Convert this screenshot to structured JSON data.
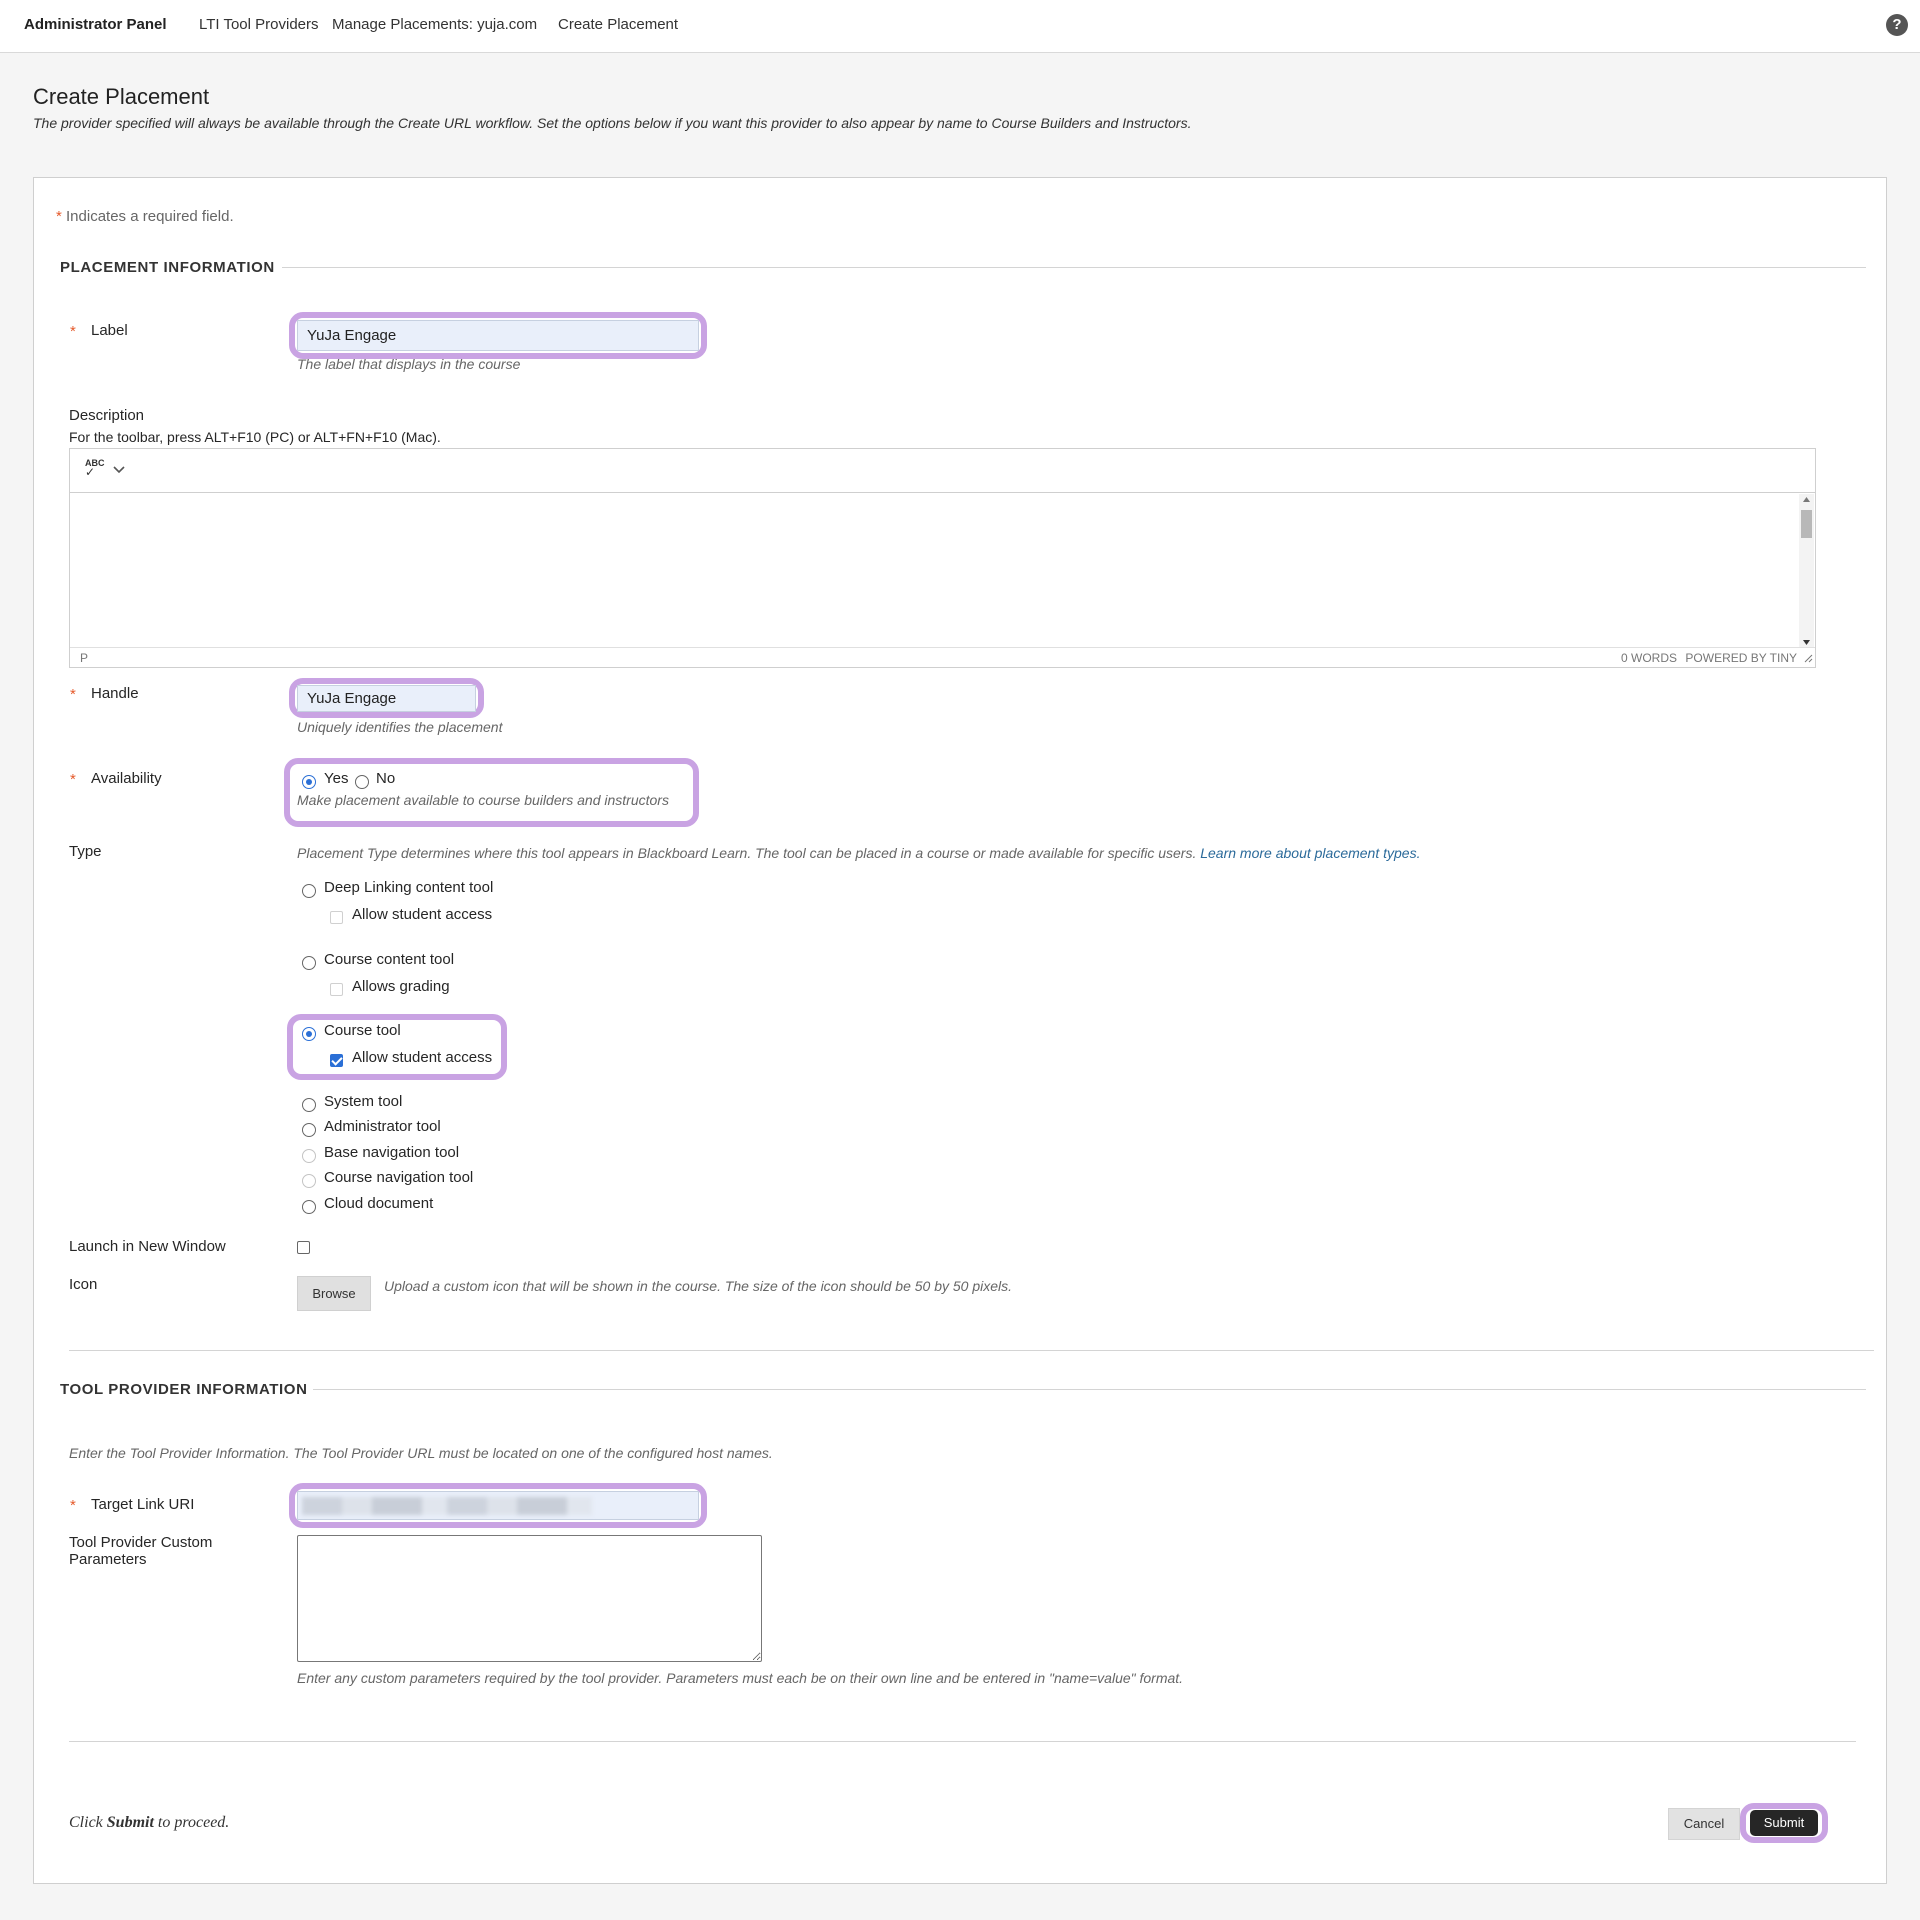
{
  "breadcrumb": {
    "items": [
      "Administrator Panel",
      "LTI Tool Providers",
      "Manage Placements: yuja.com",
      "Create Placement"
    ]
  },
  "help_icon": "?",
  "page": {
    "title": "Create Placement",
    "subtitle": "The provider specified will always be available through the Create URL workflow. Set the options below if you want this provider to also appear by name to Course Builders and Instructors."
  },
  "form": {
    "required_star": "*",
    "required_note": "Indicates a required field.",
    "placement_section": "PLACEMENT INFORMATION",
    "label": {
      "label": "Label",
      "value": "YuJa Engage",
      "hint": "The label that displays in the course"
    },
    "description": {
      "label": "Description",
      "toolbar_hint": "For the toolbar, press ALT+F10 (PC) or ALT+FN+F10 (Mac).",
      "spellcheck_icon": "ABC",
      "status_path": "P",
      "word_count": "0 WORDS",
      "powered_by": "POWERED BY TINY"
    },
    "handle": {
      "label": "Handle",
      "value": "YuJa Engage",
      "hint": "Uniquely identifies the placement"
    },
    "availability": {
      "label": "Availability",
      "yes": "Yes",
      "no": "No",
      "selected": "Yes",
      "hint": "Make placement available to course builders and instructors"
    },
    "type": {
      "label": "Type",
      "hint": "Placement Type determines where this tool appears in Blackboard Learn. The tool can be placed in a course or made available for specific users.",
      "hint_link": "Learn more about placement types.",
      "deep_linking": "Deep Linking content tool",
      "deep_linking_sub": "Allow student access",
      "course_content": "Course content tool",
      "course_content_sub": "Allows grading",
      "course_tool": "Course tool",
      "course_tool_sub": "Allow student access",
      "system_tool": "System tool",
      "administrator_tool": "Administrator tool",
      "base_navigation_tool": "Base navigation tool",
      "course_navigation_tool": "Course navigation tool",
      "cloud_document": "Cloud document",
      "selected": "Course tool"
    },
    "launch_new_window": {
      "label": "Launch in New Window",
      "checked": false
    },
    "icon": {
      "label": "Icon",
      "browse": "Browse",
      "hint": "Upload a custom icon that will be shown in the course. The size of the icon should be 50 by 50 pixels."
    },
    "tool_provider_section": "TOOL PROVIDER INFORMATION",
    "tool_provider_intro": "Enter the Tool Provider Information. The Tool Provider URL must be located on one of the configured host names.",
    "target_link": {
      "label": "Target Link URI",
      "value": ""
    },
    "custom_params": {
      "label_line1": "Tool Provider Custom",
      "label_line2": "Parameters",
      "hint": "Enter any custom parameters required by the tool provider. Parameters must each be on their own line and be entered in \"name=value\" format."
    },
    "proceed": {
      "before": "Click ",
      "bold": "Submit",
      "after": " to proceed."
    },
    "cancel": "Cancel",
    "submit": "Submit"
  },
  "colors": {
    "highlight": "#c9a3e3",
    "required": "#e55a2b",
    "accent": "#2a6fd6",
    "link": "#2b6a9a"
  }
}
